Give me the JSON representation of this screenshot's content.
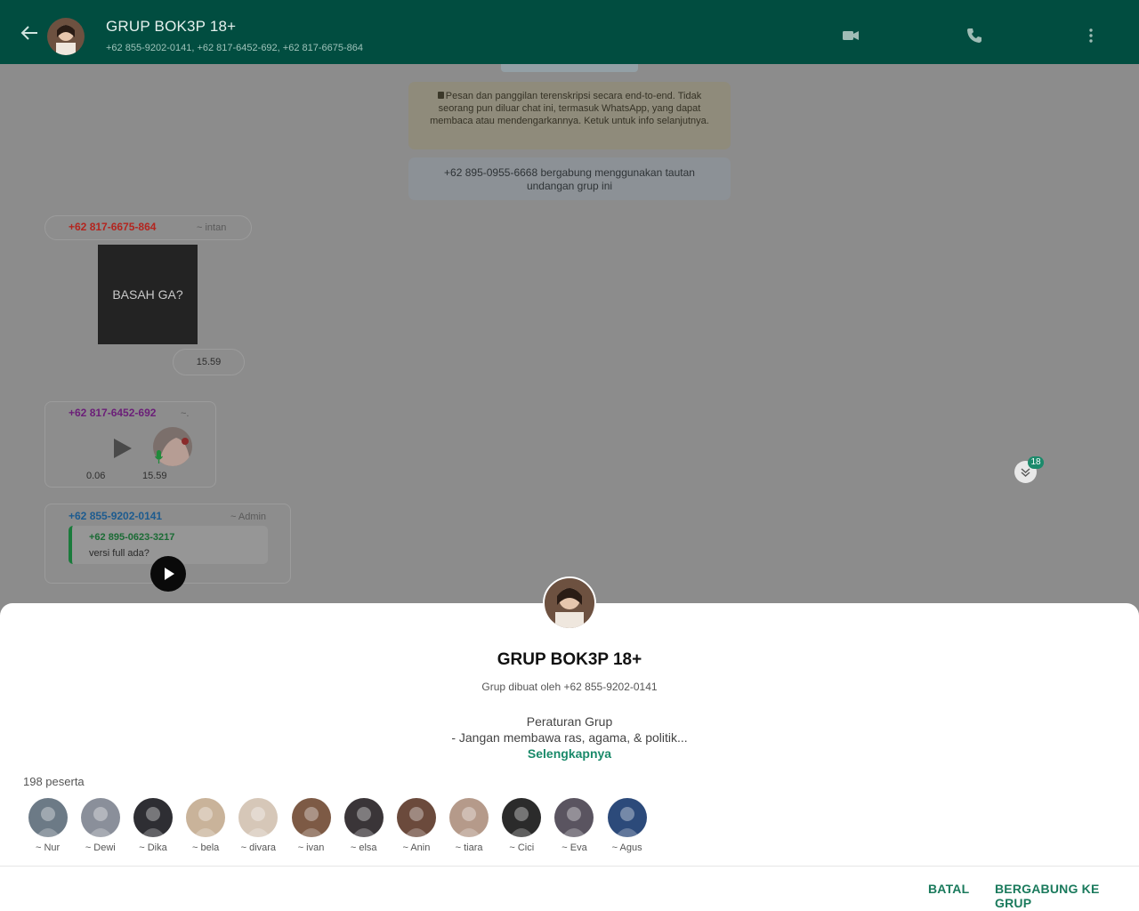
{
  "header": {
    "title": "GRUP BOK3P 18+",
    "subtitle": "+62 855-9202-0141, +62 817-6452-692, +62 817-6675-864",
    "icons": [
      "back-arrow-icon",
      "video-call-icon",
      "voice-call-icon",
      "more-options-icon"
    ]
  },
  "chat": {
    "encryption_notice": "Pesan dan panggilan terenskripsi secara end-to-end. Tidak seorang pun diluar chat ini, termasuk WhatsApp, yang dapat membaca atau mendengarkannya. Ketuk untuk info selanjutnya.",
    "join_notice": "+62 895-0955-6668 bergabung menggunakan tautan undangan grup ini",
    "msg1": {
      "sender": "+62 817-6675-864",
      "alias": "~ intan",
      "image_text": "BASAH GA?",
      "time": "15.59"
    },
    "msg2": {
      "sender": "+62 817-6452-692",
      "alias": "~.",
      "duration": "0.06",
      "time": "15.59"
    },
    "msg3": {
      "sender": "+62 855-9202-0141",
      "alias": "~ Admin",
      "quoted_sender": "+62 895-0623-3217",
      "quoted_text": "versi full ada?"
    },
    "unread_badge": "18"
  },
  "sheet": {
    "title": "GRUP BOK3P 18+",
    "created_by": "Grup dibuat oleh +62 855-9202-0141",
    "rules_title": "Peraturan Grup",
    "rules_line": "- Jangan membawa ras, agama, & politik...",
    "more": "Selengkapnya",
    "participants": "198 peserta",
    "members": [
      {
        "name": "~ Nur",
        "color": "#6c7a86"
      },
      {
        "name": "~ Dewi",
        "color": "#8a8f9a"
      },
      {
        "name": "~ Dika",
        "color": "#2e2e33"
      },
      {
        "name": "~ bela",
        "color": "#c9b39a"
      },
      {
        "name": "~ divara",
        "color": "#d6c7b8"
      },
      {
        "name": "~ ivan",
        "color": "#7d5a45"
      },
      {
        "name": "~ elsa",
        "color": "#3a3538"
      },
      {
        "name": "~ Anin",
        "color": "#6b4a3c"
      },
      {
        "name": "~ tiara",
        "color": "#b59a8a"
      },
      {
        "name": "~ Cici",
        "color": "#2b2b2b"
      },
      {
        "name": "~ Eva",
        "color": "#5a5460"
      },
      {
        "name": "~ Agus",
        "color": "#2c4a7a"
      }
    ],
    "cancel_label": "BATAL",
    "join_label": "BERGABUNG KE GRUP"
  }
}
